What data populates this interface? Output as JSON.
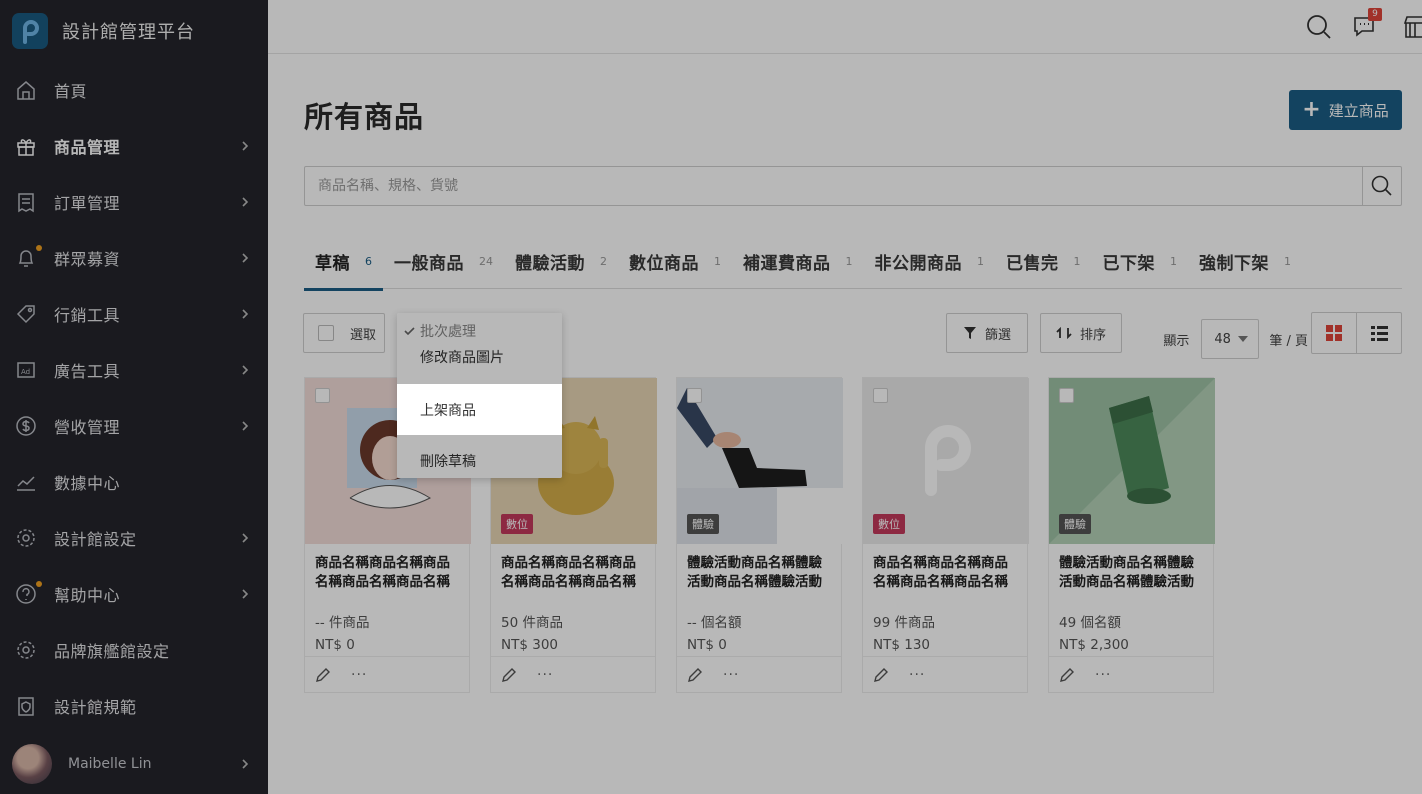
{
  "brand": {
    "title": "設計館管理平台",
    "logo_letter": "P",
    "logo_color": "#1a5a82"
  },
  "sidebar": {
    "items": [
      {
        "label": "首頁",
        "icon": "home-icon",
        "chevron": false,
        "active": false,
        "dot": false
      },
      {
        "label": "商品管理",
        "icon": "gift-icon",
        "chevron": true,
        "active": true,
        "dot": false
      },
      {
        "label": "訂單管理",
        "icon": "receipt-icon",
        "chevron": true,
        "active": false,
        "dot": false
      },
      {
        "label": "群眾募資",
        "icon": "bell-icon",
        "chevron": true,
        "active": false,
        "dot": true
      },
      {
        "label": "行銷工具",
        "icon": "tag-icon",
        "chevron": true,
        "active": false,
        "dot": false
      },
      {
        "label": "廣告工具",
        "icon": "ad-icon",
        "chevron": true,
        "active": false,
        "dot": false
      },
      {
        "label": "營收管理",
        "icon": "dollar-icon",
        "chevron": true,
        "active": false,
        "dot": false
      },
      {
        "label": "數據中心",
        "icon": "chart-icon",
        "chevron": false,
        "active": false,
        "dot": false
      },
      {
        "label": "設計館設定",
        "icon": "gear-icon",
        "chevron": true,
        "active": false,
        "dot": false
      },
      {
        "label": "幫助中心",
        "icon": "help-icon",
        "chevron": true,
        "active": false,
        "dot": true
      },
      {
        "label": "品牌旗艦館設定",
        "icon": "gear-icon",
        "chevron": false,
        "active": false,
        "dot": false
      },
      {
        "label": "設計館規範",
        "icon": "shield-icon",
        "chevron": false,
        "active": false,
        "dot": false
      }
    ],
    "user_name": "Maibelle Lin"
  },
  "topbar": {
    "notification_count": "9"
  },
  "main": {
    "title": "所有商品",
    "create_label": "建立商品",
    "search_placeholder": "商品名稱、規格、貨號",
    "tabs": [
      {
        "label": "草稿",
        "count": "6",
        "active": true
      },
      {
        "label": "一般商品",
        "count": "24",
        "active": false
      },
      {
        "label": "體驗活動",
        "count": "2",
        "active": false
      },
      {
        "label": "數位商品",
        "count": "1",
        "active": false
      },
      {
        "label": "補運費商品",
        "count": "1",
        "active": false
      },
      {
        "label": "非公開商品",
        "count": "1",
        "active": false
      },
      {
        "label": "已售完",
        "count": "1",
        "active": false
      },
      {
        "label": "已下架",
        "count": "1",
        "active": false
      },
      {
        "label": "強制下架",
        "count": "1",
        "active": false
      }
    ],
    "select_label": "選取",
    "filter_label": "篩選",
    "sort_label": "排序",
    "show_label": "顯示",
    "per_page_value": "48",
    "per_page_unit": "筆 / 頁"
  },
  "dropdown": {
    "header": "批次處理",
    "items": [
      "修改商品圖片",
      "上架商品",
      "刪除草稿"
    ],
    "highlighted": "上架商品"
  },
  "cards": [
    {
      "title": "商品名稱商品名稱商品名稱商品名稱商品名稱",
      "meta": "-- 件商品",
      "price": "NT$ 0",
      "tag": "",
      "bg": "#f3ddd9"
    },
    {
      "title": "商品名稱商品名稱商品名稱商品名稱商品名稱",
      "meta": "50 件商品",
      "price": "NT$ 300",
      "tag": "數位",
      "bg": "#e8d6b4"
    },
    {
      "title": "體驗活動商品名稱體驗活動商品名稱體驗活動",
      "meta": "-- 個名額",
      "price": "NT$ 0",
      "tag": "體驗",
      "bg": "#dfe4ea"
    },
    {
      "title": "商品名稱商品名稱商品名稱商品名稱商品名稱",
      "meta": "99 件商品",
      "price": "NT$ 130",
      "tag": "數位",
      "bg": "#eaeaea"
    },
    {
      "title": "體驗活動商品名稱體驗活動商品名稱體驗活動",
      "meta": "49 個名額",
      "price": "NT$ 2,300",
      "tag": "體驗",
      "bg": "#9fc2a6"
    }
  ],
  "colors": {
    "accent": "#1b5e86",
    "tag_digital": "#c43a5c",
    "tag_experience": "#555555",
    "sidebar": "#24252b"
  }
}
